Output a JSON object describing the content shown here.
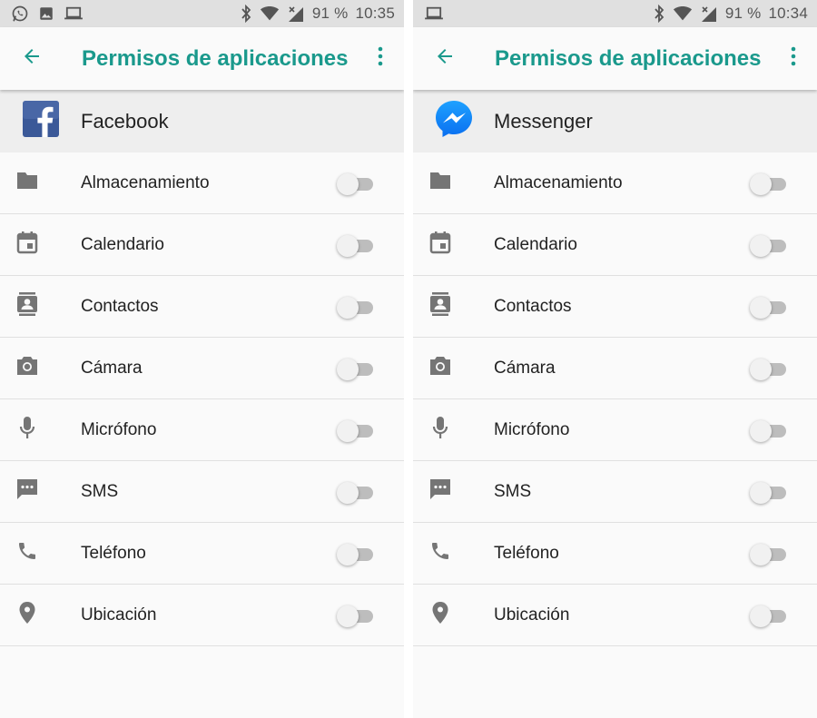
{
  "screens": [
    {
      "status": {
        "left_icons": [
          "whatsapp-icon",
          "image-icon",
          "laptop-icon"
        ],
        "battery": "91 %",
        "time": "10:35"
      },
      "toolbar": {
        "title": "Permisos de aplicaciones",
        "back_icon": "arrow-back-icon",
        "menu_icon": "more-vert-icon"
      },
      "app": {
        "name": "Facebook",
        "icon": "facebook-icon"
      },
      "permissions": [
        {
          "label": "Almacenamiento",
          "icon": "folder-icon",
          "enabled": false
        },
        {
          "label": "Calendario",
          "icon": "calendar-icon",
          "enabled": false
        },
        {
          "label": "Contactos",
          "icon": "contacts-icon",
          "enabled": false
        },
        {
          "label": "Cámara",
          "icon": "camera-icon",
          "enabled": false
        },
        {
          "label": "Micrófono",
          "icon": "microphone-icon",
          "enabled": false
        },
        {
          "label": "SMS",
          "icon": "sms-icon",
          "enabled": false
        },
        {
          "label": "Teléfono",
          "icon": "phone-icon",
          "enabled": false
        },
        {
          "label": "Ubicación",
          "icon": "location-icon",
          "enabled": false
        }
      ]
    },
    {
      "status": {
        "left_icons": [
          "laptop-icon"
        ],
        "battery": "91 %",
        "time": "10:34"
      },
      "toolbar": {
        "title": "Permisos de aplicaciones",
        "back_icon": "arrow-back-icon",
        "menu_icon": "more-vert-icon"
      },
      "app": {
        "name": "Messenger",
        "icon": "messenger-icon"
      },
      "permissions": [
        {
          "label": "Almacenamiento",
          "icon": "folder-icon",
          "enabled": false
        },
        {
          "label": "Calendario",
          "icon": "calendar-icon",
          "enabled": false
        },
        {
          "label": "Contactos",
          "icon": "contacts-icon",
          "enabled": false
        },
        {
          "label": "Cámara",
          "icon": "camera-icon",
          "enabled": false
        },
        {
          "label": "Micrófono",
          "icon": "microphone-icon",
          "enabled": false
        },
        {
          "label": "SMS",
          "icon": "sms-icon",
          "enabled": false
        },
        {
          "label": "Teléfono",
          "icon": "phone-icon",
          "enabled": false
        },
        {
          "label": "Ubicación",
          "icon": "location-icon",
          "enabled": false
        }
      ]
    }
  ],
  "colors": {
    "accent": "#1a998c",
    "status_bar": "#e0e0e0",
    "app_header": "#eeeeee",
    "icon_gray": "#757575",
    "facebook_blue": "#3b5998",
    "messenger_blue": "#0a7cff"
  }
}
